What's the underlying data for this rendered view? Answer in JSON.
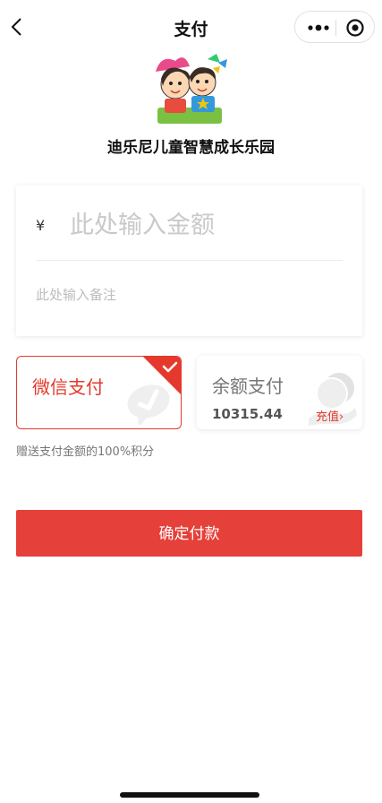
{
  "navbar": {
    "title": "支付",
    "back_icon": "chevron-left-icon",
    "more_icon": "more-dots-icon",
    "close_icon": "target-circle-icon"
  },
  "store": {
    "name": "迪乐尼儿童智慧成长乐园",
    "logo_icon": "kids-cartoon-logo"
  },
  "amount_card": {
    "currency_symbol": "¥",
    "amount_placeholder": "此处输入金额",
    "note_placeholder": "此处输入备注"
  },
  "payment_methods": {
    "wechat": {
      "label": "微信支付",
      "selected": true,
      "icon": "wechat-pay-icon"
    },
    "balance": {
      "label": "余额支付",
      "amount": "10315.44",
      "recharge_label": "充值",
      "recharge_arrow": "›",
      "icon": "coins-icon"
    }
  },
  "points_note": "赠送支付金额的100%积分",
  "confirm_button": "确定付款",
  "colors": {
    "accent": "#e4392c",
    "button": "#e6403a"
  }
}
